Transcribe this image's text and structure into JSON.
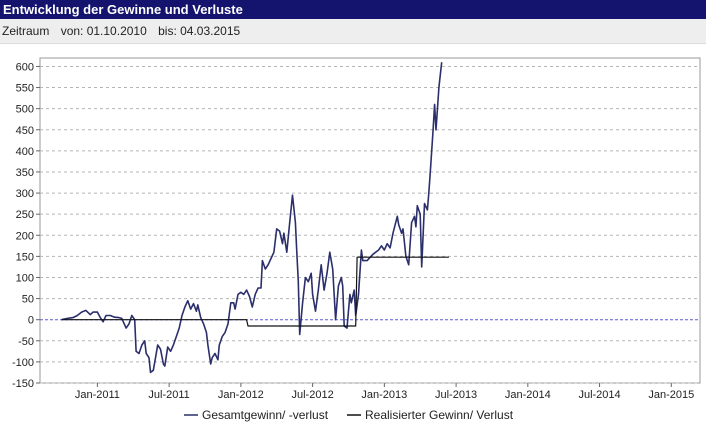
{
  "header": {
    "title": "Entwicklung der Gewinne und Verluste"
  },
  "period": {
    "label": "Zeitraum",
    "from": "von: 01.10.2010",
    "to": "bis: 04.03.2015"
  },
  "colors": {
    "header_bg": "#14146e",
    "series1": "#2b2f6b",
    "series2": "#111111",
    "zero_line": "#5b5bd6"
  },
  "chart_data": {
    "type": "line",
    "y_ticks": [
      600,
      550,
      500,
      450,
      400,
      350,
      300,
      250,
      200,
      150,
      100,
      50,
      0,
      -50,
      -100,
      -150
    ],
    "ylim": [
      -150,
      620
    ],
    "xlim": [
      -0.15,
      4.45
    ],
    "x_tick_labels": [
      {
        "x": 0.25,
        "label": "Jan-2011"
      },
      {
        "x": 0.75,
        "label": "Jul-2011"
      },
      {
        "x": 1.25,
        "label": "Jan-2012"
      },
      {
        "x": 1.75,
        "label": "Jul-2012"
      },
      {
        "x": 2.25,
        "label": "Jan-2013"
      },
      {
        "x": 2.75,
        "label": "Jul-2013"
      },
      {
        "x": 3.25,
        "label": "Jan-2014"
      },
      {
        "x": 3.75,
        "label": "Jul-2014"
      },
      {
        "x": 4.25,
        "label": "Jan-2015"
      }
    ],
    "grid": true,
    "legend": "bottom",
    "series": [
      {
        "name": "Gesamtgewinn/ -verlust",
        "points": [
          [
            0.0,
            0
          ],
          [
            0.04,
            3
          ],
          [
            0.08,
            5
          ],
          [
            0.11,
            10
          ],
          [
            0.14,
            18
          ],
          [
            0.17,
            22
          ],
          [
            0.2,
            12
          ],
          [
            0.22,
            18
          ],
          [
            0.25,
            18
          ],
          [
            0.27,
            5
          ],
          [
            0.29,
            -5
          ],
          [
            0.31,
            10
          ],
          [
            0.34,
            10
          ],
          [
            0.37,
            6
          ],
          [
            0.4,
            5
          ],
          [
            0.42,
            3
          ],
          [
            0.45,
            -20
          ],
          [
            0.47,
            -10
          ],
          [
            0.49,
            10
          ],
          [
            0.51,
            0
          ],
          [
            0.52,
            -75
          ],
          [
            0.54,
            -80
          ],
          [
            0.56,
            -60
          ],
          [
            0.58,
            -50
          ],
          [
            0.59,
            -80
          ],
          [
            0.61,
            -90
          ],
          [
            0.62,
            -125
          ],
          [
            0.64,
            -120
          ],
          [
            0.65,
            -100
          ],
          [
            0.67,
            -60
          ],
          [
            0.69,
            -70
          ],
          [
            0.71,
            -105
          ],
          [
            0.72,
            -110
          ],
          [
            0.74,
            -65
          ],
          [
            0.76,
            -75
          ],
          [
            0.78,
            -60
          ],
          [
            0.8,
            -40
          ],
          [
            0.82,
            -20
          ],
          [
            0.84,
            10
          ],
          [
            0.86,
            30
          ],
          [
            0.88,
            45
          ],
          [
            0.9,
            25
          ],
          [
            0.92,
            38
          ],
          [
            0.94,
            20
          ],
          [
            0.95,
            35
          ],
          [
            0.97,
            5
          ],
          [
            0.99,
            -10
          ],
          [
            1.01,
            -30
          ],
          [
            1.02,
            -60
          ],
          [
            1.04,
            -105
          ],
          [
            1.05,
            -90
          ],
          [
            1.07,
            -80
          ],
          [
            1.09,
            -95
          ],
          [
            1.1,
            -60
          ],
          [
            1.12,
            -40
          ],
          [
            1.14,
            -30
          ],
          [
            1.16,
            -10
          ],
          [
            1.18,
            40
          ],
          [
            1.2,
            40
          ],
          [
            1.21,
            25
          ],
          [
            1.23,
            60
          ],
          [
            1.25,
            65
          ],
          [
            1.27,
            60
          ],
          [
            1.29,
            70
          ],
          [
            1.31,
            55
          ],
          [
            1.33,
            30
          ],
          [
            1.35,
            60
          ],
          [
            1.37,
            75
          ],
          [
            1.39,
            75
          ],
          [
            1.4,
            140
          ],
          [
            1.42,
            120
          ],
          [
            1.44,
            130
          ],
          [
            1.46,
            145
          ],
          [
            1.48,
            160
          ],
          [
            1.5,
            215
          ],
          [
            1.52,
            210
          ],
          [
            1.54,
            180
          ],
          [
            1.55,
            205
          ],
          [
            1.57,
            160
          ],
          [
            1.59,
            230
          ],
          [
            1.61,
            295
          ],
          [
            1.63,
            230
          ],
          [
            1.64,
            160
          ],
          [
            1.65,
            90
          ],
          [
            1.66,
            -35
          ],
          [
            1.68,
            40
          ],
          [
            1.7,
            100
          ],
          [
            1.72,
            90
          ],
          [
            1.74,
            110
          ],
          [
            1.75,
            60
          ],
          [
            1.77,
            20
          ],
          [
            1.79,
            70
          ],
          [
            1.81,
            130
          ],
          [
            1.83,
            70
          ],
          [
            1.85,
            110
          ],
          [
            1.87,
            160
          ],
          [
            1.89,
            120
          ],
          [
            1.91,
            0
          ],
          [
            1.93,
            80
          ],
          [
            1.95,
            100
          ],
          [
            1.96,
            80
          ],
          [
            1.97,
            -15
          ],
          [
            1.99,
            -20
          ],
          [
            2.01,
            60
          ],
          [
            2.02,
            40
          ],
          [
            2.04,
            70
          ],
          [
            2.05,
            10
          ],
          [
            2.07,
            60
          ],
          [
            2.09,
            165
          ],
          [
            2.1,
            140
          ],
          [
            2.13,
            140
          ],
          [
            2.17,
            155
          ],
          [
            2.21,
            165
          ],
          [
            2.23,
            175
          ],
          [
            2.25,
            165
          ],
          [
            2.27,
            180
          ],
          [
            2.29,
            170
          ],
          [
            2.31,
            205
          ],
          [
            2.34,
            245
          ],
          [
            2.35,
            225
          ],
          [
            2.37,
            205
          ],
          [
            2.38,
            215
          ],
          [
            2.4,
            150
          ],
          [
            2.42,
            130
          ],
          [
            2.44,
            230
          ],
          [
            2.46,
            245
          ],
          [
            2.47,
            220
          ],
          [
            2.48,
            270
          ],
          [
            2.5,
            250
          ],
          [
            2.51,
            125
          ],
          [
            2.53,
            275
          ],
          [
            2.55,
            260
          ],
          [
            2.56,
            300
          ],
          [
            2.57,
            350
          ],
          [
            2.59,
            450
          ],
          [
            2.6,
            510
          ],
          [
            2.61,
            450
          ],
          [
            2.63,
            550
          ],
          [
            2.65,
            610
          ]
        ]
      },
      {
        "name": "Realisierter Gewinn/ Verlust",
        "points": [
          [
            0.0,
            0
          ],
          [
            1.29,
            0
          ],
          [
            1.3,
            -15
          ],
          [
            2.05,
            -15
          ],
          [
            2.06,
            148
          ],
          [
            2.7,
            148
          ]
        ]
      }
    ]
  },
  "legend": {
    "series1": "Gesamtgewinn/ -verlust",
    "series2": "Realisierter Gewinn/ Verlust"
  }
}
